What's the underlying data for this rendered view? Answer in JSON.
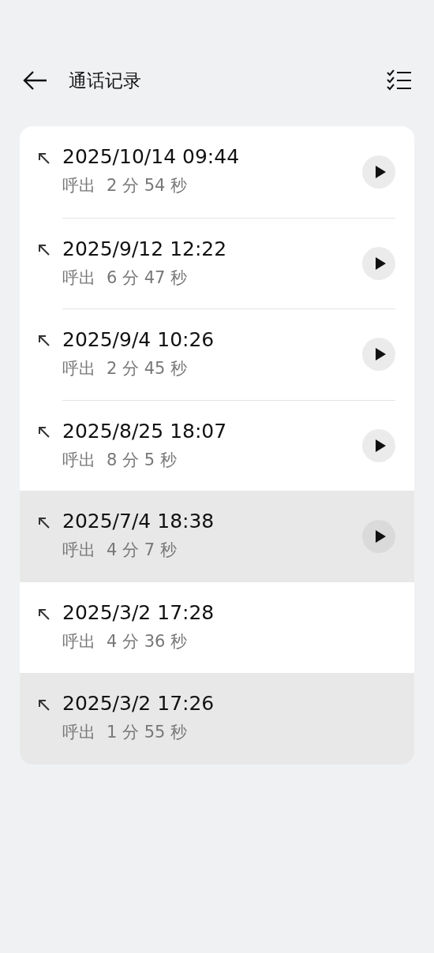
{
  "header": {
    "title": "通话记录"
  },
  "calls": [
    {
      "time": "2025/10/14 09:44",
      "type": "呼出",
      "duration": "2 分 54 秒",
      "playable": true,
      "selected": false
    },
    {
      "time": "2025/9/12 12:22",
      "type": "呼出",
      "duration": "6 分 47 秒",
      "playable": true,
      "selected": false
    },
    {
      "time": "2025/9/4 10:26",
      "type": "呼出",
      "duration": "2 分 45 秒",
      "playable": true,
      "selected": false
    },
    {
      "time": "2025/8/25 18:07",
      "type": "呼出",
      "duration": "8 分 5 秒",
      "playable": true,
      "selected": false
    },
    {
      "time": "2025/7/4 18:38",
      "type": "呼出",
      "duration": "4 分 7 秒",
      "playable": true,
      "selected": true
    },
    {
      "time": "2025/3/2 17:28",
      "type": "呼出",
      "duration": "4 分 36 秒",
      "playable": false,
      "selected": false
    },
    {
      "time": "2025/3/2 17:26",
      "type": "呼出",
      "duration": "1 分 55 秒",
      "playable": false,
      "selected": true
    }
  ]
}
